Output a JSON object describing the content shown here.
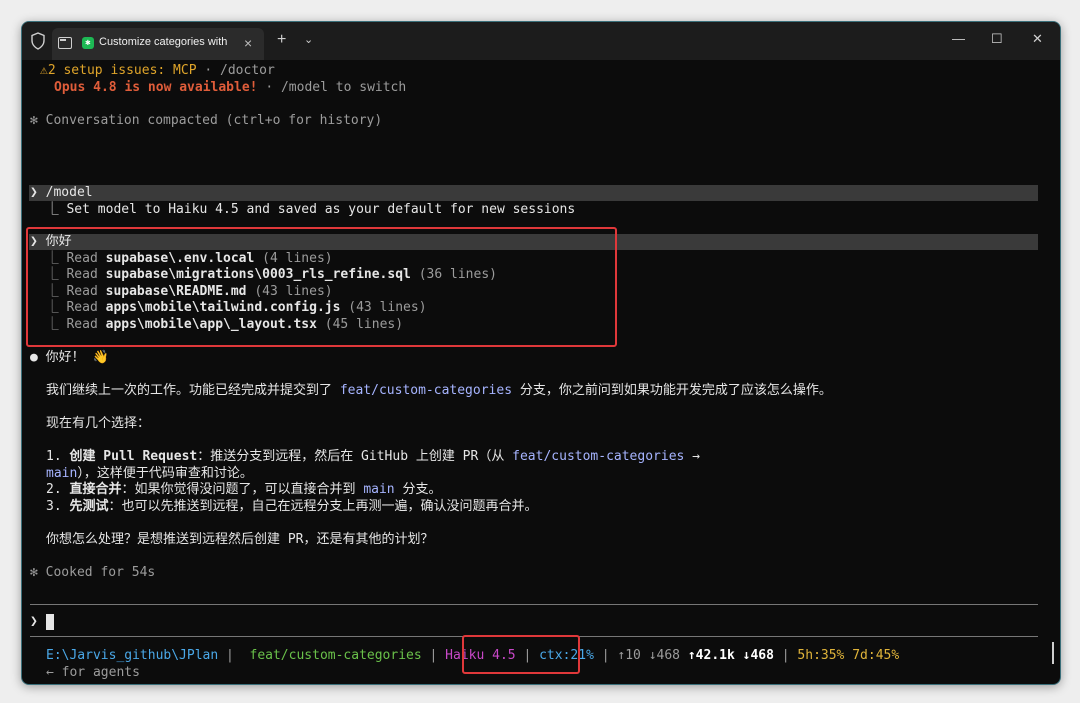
{
  "titlebar": {
    "tab_title": "Customize categories with",
    "tab_close": "×",
    "new_tab": "+",
    "dropdown": "⌄",
    "minimize": "—",
    "maximize": "☐",
    "close": "✕"
  },
  "notices": {
    "warn_icon": "⚠",
    "setup_issues": "2 setup issues: MCP",
    "setup_sep": " · /doctor",
    "opus_available": "Opus 4.8 is now available!",
    "opus_switch": " · /model to switch"
  },
  "compacted": "✻ Conversation compacted (ctrl+o for history)",
  "model_cmd": {
    "prompt": "❯ /model",
    "result": "  ⎿ Set model to Haiku 4.5 and saved as your default for new sessions"
  },
  "hello_cmd": {
    "prompt": "❯ 你好",
    "reads": [
      {
        "prefix": "  ⎿ Read ",
        "path": "supabase\\.env.local",
        "suffix": " (4 lines)"
      },
      {
        "prefix": "  ⎿ Read ",
        "path": "supabase\\migrations\\0003_rls_refine.sql",
        "suffix": " (36 lines)"
      },
      {
        "prefix": "  ⎿ Read ",
        "path": "supabase\\README.md",
        "suffix": " (43 lines)"
      },
      {
        "prefix": "  ⎿ Read ",
        "path": "apps\\mobile\\tailwind.config.js",
        "suffix": " (43 lines)"
      },
      {
        "prefix": "  ⎿ Read ",
        "path": "apps\\mobile\\app\\_layout.tsx",
        "suffix": " (45 lines)"
      }
    ]
  },
  "reply": {
    "bullet": "●",
    "greeting": " 你好！ 👋",
    "p1_a": "我们继续上一次的工作。功能已经完成并提交到了 ",
    "p1_code": "feat/custom-categories",
    "p1_b": " 分支，你之前问到如果功能开发完成了应该怎么操作。",
    "p2": "现在有几个选择：",
    "o1_num": "1. ",
    "o1_bold": "创建 Pull Request",
    "o1_text": "：推送分支到远程，然后在 GitHub 上创建 PR（从 ",
    "o1_code": "feat/custom-categories",
    "o1_arrow": " →",
    "o1_code2": "main",
    "o1_text2": "），这样便于代码审查和讨论。",
    "o2_num": "2. ",
    "o2_bold": "直接合并",
    "o2_text": "：如果你觉得没问题了，可以直接合并到 ",
    "o2_code": "main",
    "o2_text2": " 分支。",
    "o3_num": "3. ",
    "o3_bold": "先测试",
    "o3_text": "：也可以先推送到远程，自己在远程分支上再测一遍，确认没问题再合并。",
    "question": "你想怎么处理？是想推送到远程然后创建 PR，还是有其他的计划？"
  },
  "cooked": "✻ Cooked for 54s",
  "input_prompt": "❯ ",
  "status": {
    "path": "E:\\Jarvis_github\\JPlan",
    "sep1": " | ",
    "branch": " feat/custom-categories",
    "sep2": " | ",
    "model": "Haiku 4.5",
    "sep3": " | ",
    "ctx": "ctx:21%",
    "sep4": " | ",
    "tokens_dim": "↑10 ↓468 ",
    "tokens_bold": "↑42.1k ↓468",
    "sep5": " | ",
    "limits": "5h:35% 7d:45%",
    "agents": "← for agents"
  }
}
